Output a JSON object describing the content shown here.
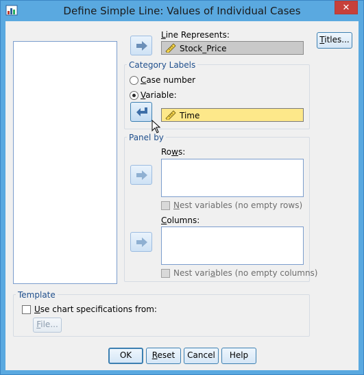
{
  "window": {
    "title": "Define Simple Line: Values of Individual Cases",
    "close_label": "✕"
  },
  "line_represents": {
    "label_u": "L",
    "label_rest": "ine Represents:",
    "value": "Stock_Price"
  },
  "titles_button": {
    "label_u": "T",
    "label_rest": "itles..."
  },
  "category_labels": {
    "title": "Category Labels",
    "case_number": {
      "label_u": "C",
      "label_rest": "ase number",
      "checked": false
    },
    "variable": {
      "label_u": "V",
      "label_rest": "ariable:",
      "checked": true
    },
    "variable_value": "Time"
  },
  "panel_by": {
    "title": "Panel by",
    "rows_label_pre": "Ro",
    "rows_label_u": "w",
    "rows_label_rest": "s:",
    "nest_rows_u": "N",
    "nest_rows_rest": "est variables (no empty rows)",
    "columns_label_u": "C",
    "columns_label_rest": "olumns:",
    "nest_cols_pre": "Nest vari",
    "nest_cols_u": "a",
    "nest_cols_rest": "bles (no empty columns)"
  },
  "template": {
    "title": "Template",
    "use_spec_u": "U",
    "use_spec_rest": "se chart specifications from:",
    "file_u": "F",
    "file_rest": "ile..."
  },
  "buttons": {
    "ok": "OK",
    "reset_u": "R",
    "reset_rest": "eset",
    "cancel": "Cancel",
    "help": "Help"
  },
  "colors": {
    "title_bar": "#5aa9e0",
    "close_button": "#c7403a",
    "selected_field": "#fde88a",
    "group_title": "#1e4e8c"
  },
  "icons": [
    "app-icon",
    "close-icon",
    "arrow-right-icon",
    "arrow-left-icon",
    "ruler-icon",
    "mouse-cursor-icon"
  ]
}
